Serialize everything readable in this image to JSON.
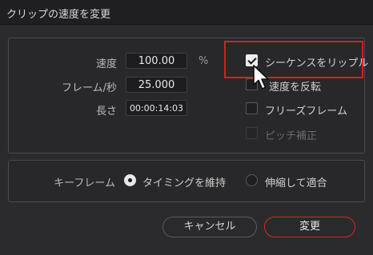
{
  "window": {
    "title": "クリップの速度を変更"
  },
  "speed": {
    "label": "速度",
    "value": "100.00",
    "unit": "%"
  },
  "fps": {
    "label": "フレーム/秒",
    "value": "25.000"
  },
  "duration": {
    "label": "長さ",
    "value": "00:00:14:03"
  },
  "options": {
    "ripple_sequence": {
      "label": "シーケンスをリップル",
      "checked": true
    },
    "reverse_speed": {
      "label": "速度を反転",
      "checked": false
    },
    "freeze_frame": {
      "label": "フリーズフレーム",
      "checked": false
    },
    "pitch_correction": {
      "label": "ピッチ補正",
      "checked": false,
      "disabled": true
    }
  },
  "keyframe": {
    "label": "キーフレーム",
    "maintain_timing": {
      "label": "タイミングを維持",
      "selected": true
    },
    "stretch_to_fit": {
      "label": "伸縮して適合",
      "selected": false
    }
  },
  "buttons": {
    "cancel": "キャンセル",
    "change": "変更"
  },
  "colors": {
    "highlight": "#d91f1f",
    "primary_border": "#d42828"
  }
}
